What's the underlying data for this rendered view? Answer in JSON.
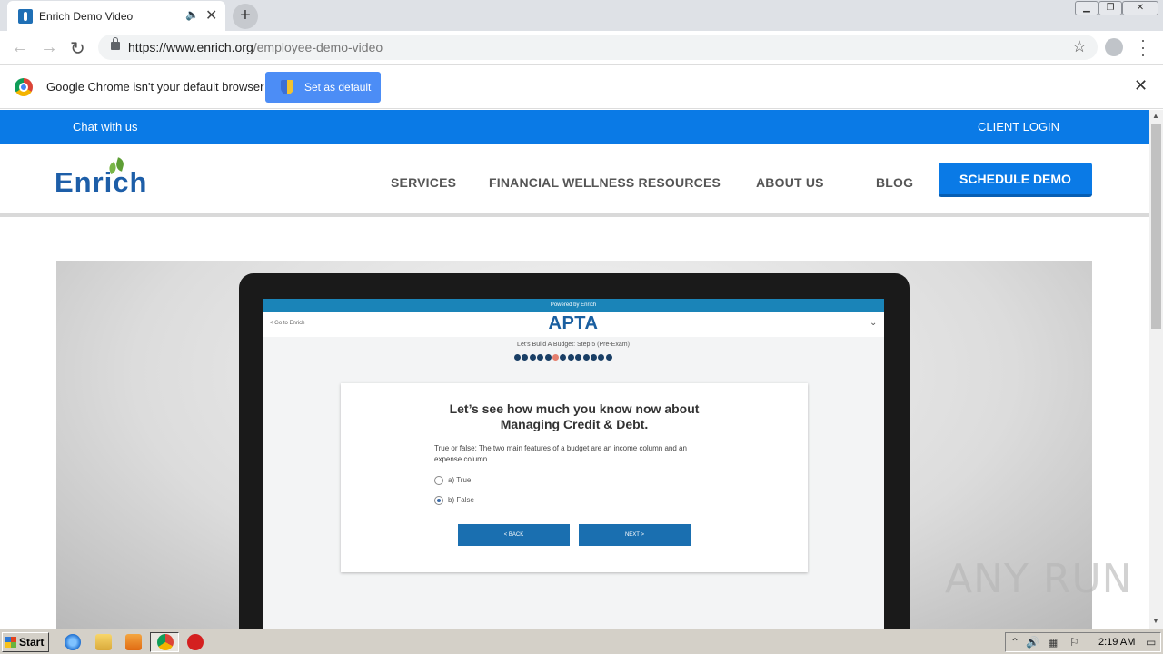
{
  "browser": {
    "tab_title": "Enrich Demo Video",
    "tab_audio_icon": "speaker-icon",
    "new_tab_label": "+",
    "url_host": "https://www.enrich.org",
    "url_path": "/employee-demo-video",
    "infobar_message": "Google Chrome isn't your default browser",
    "infobar_button": "Set as default"
  },
  "site": {
    "topbar": {
      "chat": "Chat with us",
      "login": "CLIENT LOGIN"
    },
    "logo": "Enrich",
    "nav": [
      "SERVICES",
      "FINANCIAL WELLNESS RESOURCES",
      "ABOUT US",
      "BLOG"
    ],
    "cta": "SCHEDULE DEMO",
    "brand_color": "#0a7ae6"
  },
  "video": {
    "powered_by": "Powered by Enrich",
    "goto": "< Go to Enrich",
    "brand": "APTA",
    "step": "Let's Build A Budget: Step 5 (Pre-Exam)",
    "progress_total": 13,
    "progress_active_index": 5,
    "heading_line1": "Let’s see how much you know now about",
    "heading_line2": "Managing Credit & Debt.",
    "question": "True or false: The two main features of a budget are an income column and an expense column.",
    "option_a": "a) True",
    "option_b": "b) False",
    "selected_option": "b",
    "back": "< BACK",
    "next": "NEXT >"
  },
  "watermark": "ANY RUN",
  "taskbar": {
    "start": "Start",
    "time": "2:19 AM"
  }
}
